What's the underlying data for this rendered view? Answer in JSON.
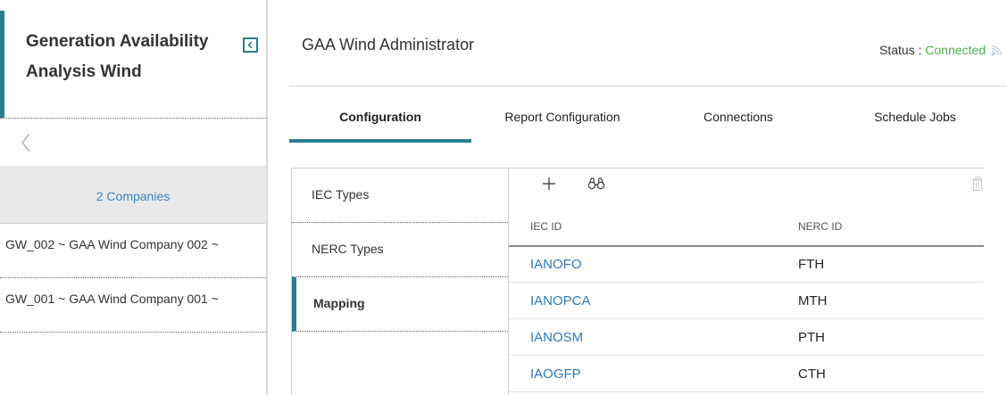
{
  "app": {
    "title": "Generation Availability Analysis Wind"
  },
  "companies": {
    "header": "2 Companies",
    "items": [
      {
        "label": "GW_002 ~ GAA Wind Company 002 ~"
      },
      {
        "label": "GW_001 ~ GAA Wind Company 001 ~"
      }
    ]
  },
  "main": {
    "title": "GAA Wind Administrator",
    "status_label": "Status : ",
    "status_value": "Connected",
    "status_color": "#4caf50"
  },
  "tabs": [
    {
      "label": "Configuration",
      "active": true
    },
    {
      "label": "Report Configuration",
      "active": false
    },
    {
      "label": "Connections",
      "active": false
    },
    {
      "label": "Schedule Jobs",
      "active": false
    }
  ],
  "subnav": [
    {
      "label": "IEC Types",
      "active": false
    },
    {
      "label": "NERC Types",
      "active": false
    },
    {
      "label": "Mapping",
      "active": true
    }
  ],
  "toolbar": {
    "icons": [
      "plus-icon",
      "binoculars-icon",
      "trash-icon"
    ]
  },
  "grid": {
    "columns": [
      "IEC ID",
      "NERC ID"
    ],
    "rows": [
      {
        "iec": "IANOFO",
        "nerc": "FTH"
      },
      {
        "iec": "IANOPCA",
        "nerc": "MTH"
      },
      {
        "iec": "IANOSM",
        "nerc": "PTH"
      },
      {
        "iec": "IAOGFP",
        "nerc": "CTH"
      }
    ]
  },
  "colors": {
    "accent": "#2a7f8f",
    "link": "#2f78b8",
    "connected": "#4caf50"
  }
}
